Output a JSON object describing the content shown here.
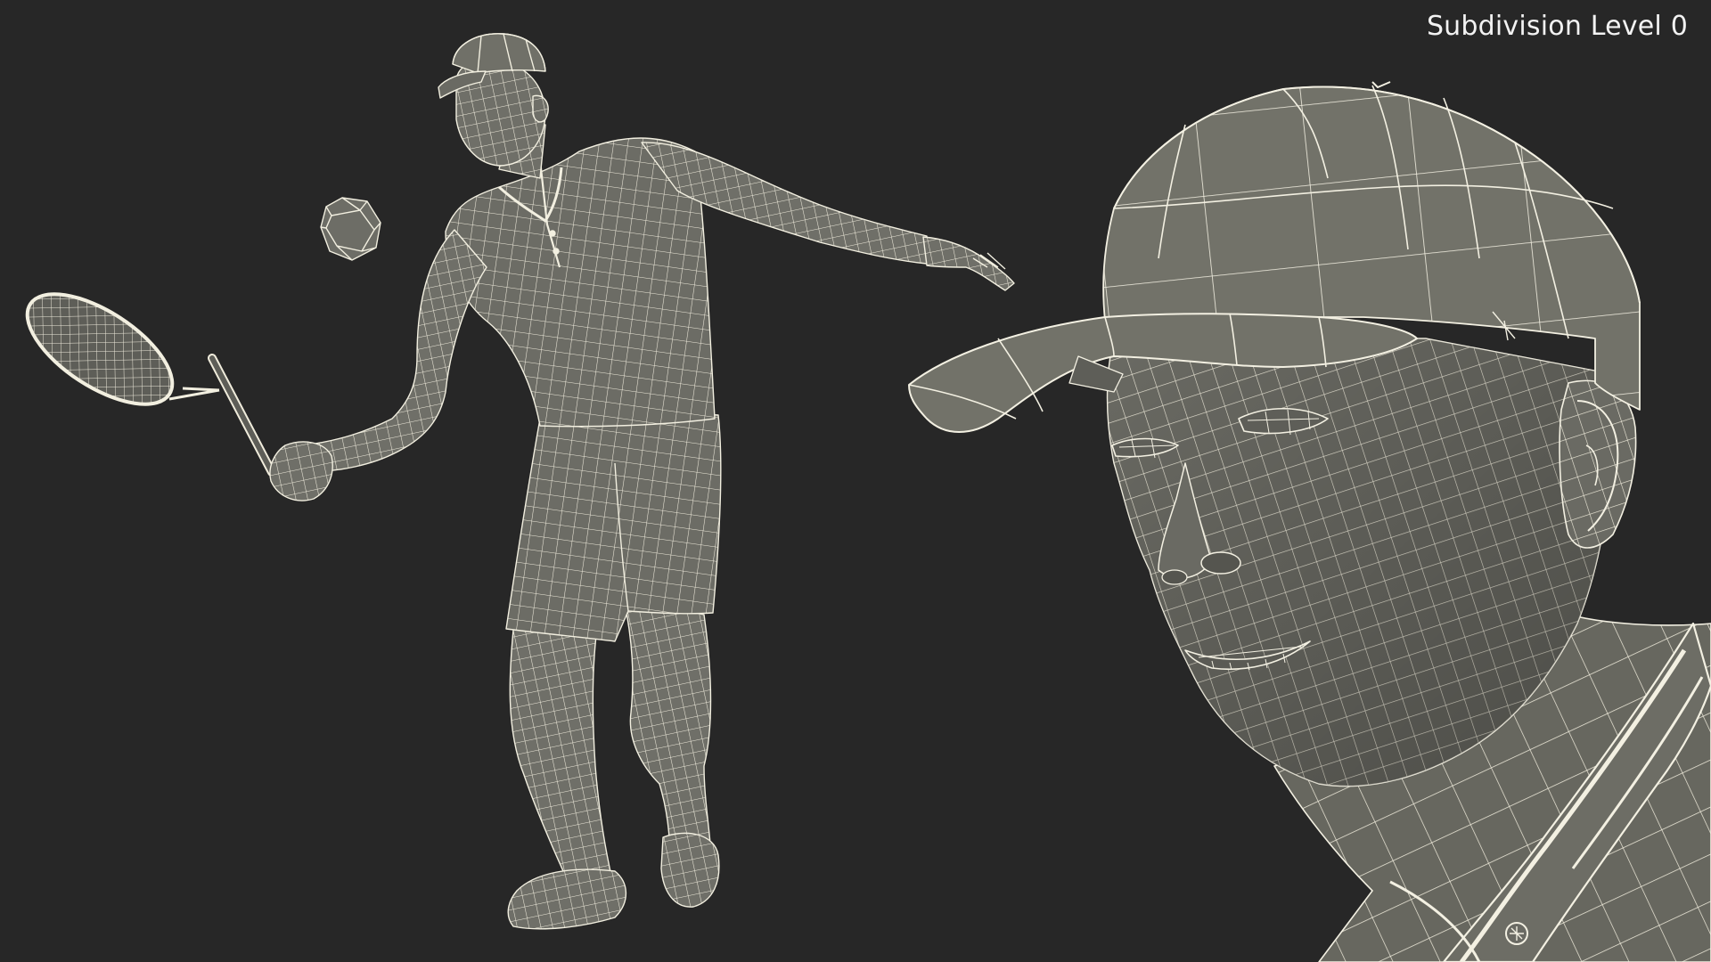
{
  "render": {
    "caption": "Subdivision Level 0",
    "background_color": "#272727",
    "surface_color": "#6f6f68",
    "wire_color": "#f3f0e2"
  }
}
